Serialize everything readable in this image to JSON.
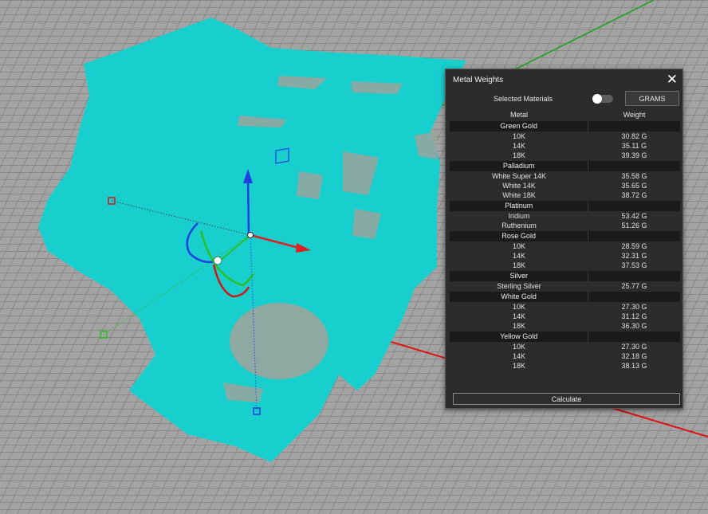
{
  "viewport": {
    "model_color": "#16d0d0",
    "background_color": "#a3a3a3",
    "grid_color": "#6e6e6e"
  },
  "panel": {
    "title": "Metal Weights",
    "close_glyph": "✕",
    "selected_materials_label": "Selected Materials",
    "selected_materials_on": false,
    "units_button": "GRAMS",
    "col_metal": "Metal",
    "col_weight": "Weight",
    "calculate_label": "Calculate",
    "groups": [
      {
        "name": "Green Gold",
        "rows": [
          {
            "metal": "10K",
            "weight": "30.82 G"
          },
          {
            "metal": "14K",
            "weight": "35.11 G"
          },
          {
            "metal": "18K",
            "weight": "39.39 G"
          }
        ]
      },
      {
        "name": "Palladium",
        "rows": [
          {
            "metal": "White Super 14K",
            "weight": "35.58 G"
          },
          {
            "metal": "White 14K",
            "weight": "35.65 G"
          },
          {
            "metal": "White 18K",
            "weight": "38.72 G"
          }
        ]
      },
      {
        "name": "Platinum",
        "rows": [
          {
            "metal": "Iridium",
            "weight": "53.42 G"
          },
          {
            "metal": "Ruthenium",
            "weight": "51.26 G"
          }
        ]
      },
      {
        "name": "Rose Gold",
        "rows": [
          {
            "metal": "10K",
            "weight": "28.59 G"
          },
          {
            "metal": "14K",
            "weight": "32.31 G"
          },
          {
            "metal": "18K",
            "weight": "37.53 G"
          }
        ]
      },
      {
        "name": "Silver",
        "rows": [
          {
            "metal": "Sterling Silver",
            "weight": "25.77 G"
          }
        ]
      },
      {
        "name": "White Gold",
        "rows": [
          {
            "metal": "10K",
            "weight": "27.30 G"
          },
          {
            "metal": "14K",
            "weight": "31.12 G"
          },
          {
            "metal": "18K",
            "weight": "36.30 G"
          }
        ]
      },
      {
        "name": "Yellow Gold",
        "rows": [
          {
            "metal": "10K",
            "weight": "27.30 G"
          },
          {
            "metal": "14K",
            "weight": "32.18 G"
          },
          {
            "metal": "18K",
            "weight": "38.13 G"
          }
        ]
      }
    ]
  }
}
